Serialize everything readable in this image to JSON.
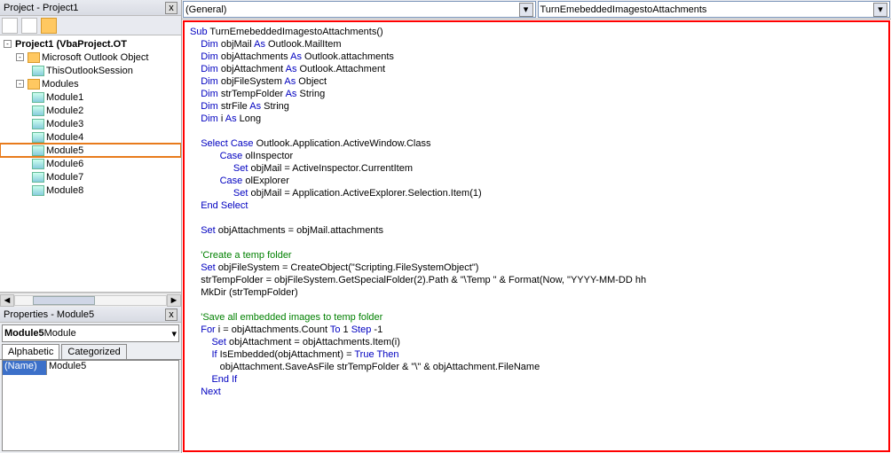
{
  "project_panel": {
    "title": "Project - Project1",
    "close": "x"
  },
  "tree": {
    "root": "Project1 (VbaProject.OT",
    "outlook_objects": "Microsoft Outlook Object",
    "session": "ThisOutlookSession",
    "modules_folder": "Modules",
    "modules": [
      "Module1",
      "Module2",
      "Module3",
      "Module4",
      "Module5",
      "Module6",
      "Module7",
      "Module8"
    ],
    "highlighted": "Module5"
  },
  "properties": {
    "title": "Properties - Module5",
    "close": "x",
    "selector_name": "Module5",
    "selector_type": " Module",
    "tabs": {
      "alphabetic": "Alphabetic",
      "categorized": "Categorized"
    },
    "row": {
      "key": "(Name)",
      "val": "Module5"
    }
  },
  "dropdowns": {
    "left": "(General)",
    "right": "TurnEmebeddedImagestoAttachments"
  },
  "code": {
    "l01a": "Sub",
    "l01b": " TurnEmebeddedImagestoAttachments()",
    "l02a": "    Dim",
    "l02b": " objMail ",
    "l02c": "As",
    "l02d": " Outlook.MailItem",
    "l03a": "    Dim",
    "l03b": " objAttachments ",
    "l03c": "As",
    "l03d": " Outlook.attachments",
    "l04a": "    Dim",
    "l04b": " objAttachment ",
    "l04c": "As",
    "l04d": " Outlook.Attachment",
    "l05a": "    Dim",
    "l05b": " objFileSystem ",
    "l05c": "As",
    "l05d": " Object",
    "l06a": "    Dim",
    "l06b": " strTempFolder ",
    "l06c": "As",
    "l06d": " String",
    "l07a": "    Dim",
    "l07b": " strFile ",
    "l07c": "As",
    "l07d": " String",
    "l08a": "    Dim",
    "l08b": " i ",
    "l08c": "As",
    "l08d": " Long",
    "l09": " ",
    "l10a": "    Select Case",
    "l10b": " Outlook.Application.ActiveWindow.Class",
    "l11a": "           Case",
    "l11b": " olInspector",
    "l12a": "                Set",
    "l12b": " objMail = ActiveInspector.CurrentItem",
    "l13a": "           Case",
    "l13b": " olExplorer",
    "l14a": "                Set",
    "l14b": " objMail = Application.ActiveExplorer.Selection.Item(1)",
    "l15a": "    End Select",
    "l16": " ",
    "l17a": "    Set",
    "l17b": " objAttachments = objMail.attachments",
    "l18": " ",
    "l19": "    'Create a temp folder",
    "l20a": "    Set",
    "l20b": " objFileSystem = CreateObject(\"Scripting.FileSystemObject\")",
    "l21": "    strTempFolder = objFileSystem.GetSpecialFolder(2).Path & \"\\Temp \" & Format(Now, \"YYYY-MM-DD hh",
    "l22": "    MkDir (strTempFolder)",
    "l23": " ",
    "l24": "    'Save all embedded images to temp folder",
    "l25a": "    For",
    "l25b": " i = objAttachments.Count ",
    "l25c": "To",
    "l25d": " 1 ",
    "l25e": "Step",
    "l25f": " -1",
    "l26a": "        Set",
    "l26b": " objAttachment = objAttachments.Item(i)",
    "l27a": "        If",
    "l27b": " IsEmbedded(objAttachment) = ",
    "l27c": "True Then",
    "l28": "           objAttachment.SaveAsFile strTempFolder & \"\\\" & objAttachment.FileName",
    "l29a": "        End If",
    "l30a": "    Next"
  }
}
